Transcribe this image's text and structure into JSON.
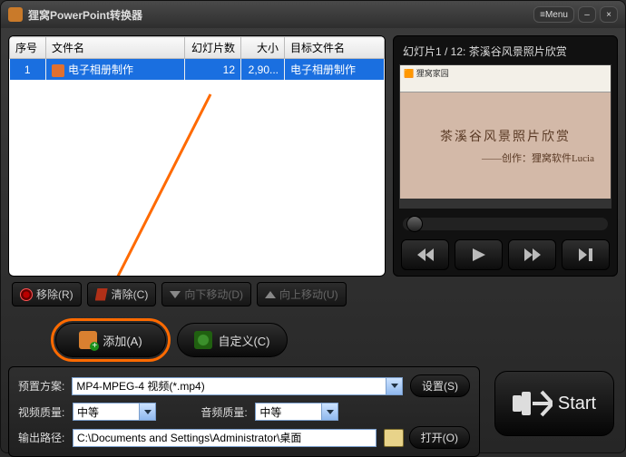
{
  "titlebar": {
    "title": "狸窝PowerPoint转换器",
    "menu": "≡Menu"
  },
  "table": {
    "headers": {
      "num": "序号",
      "name": "文件名",
      "slides": "幻灯片数",
      "size": "大小",
      "target": "目标文件名"
    },
    "rows": [
      {
        "num": "1",
        "name": "电子相册制作",
        "slides": "12",
        "size": "2,90...",
        "target": "电子相册制作"
      }
    ]
  },
  "toolbar": {
    "remove": "移除(R)",
    "clear": "清除(C)",
    "movedown": "向下移动(D)",
    "moveup": "向上移动(U)"
  },
  "bigbuttons": {
    "add": "添加(A)",
    "custom": "自定义(C)"
  },
  "preview": {
    "label": "幻灯片1 / 12: 茶溪谷风景照片欣赏",
    "slide_top": "狸窝家园",
    "slide_title": "茶溪谷风景照片欣赏",
    "slide_sub": "——创作：狸窝软件Lucia"
  },
  "settings": {
    "preset_label": "预置方案:",
    "preset_value": "MP4-MPEG-4 视频(*.mp4)",
    "set_btn": "设置(S)",
    "vq_label": "视频质量:",
    "vq_value": "中等",
    "aq_label": "音频质量:",
    "aq_value": "中等",
    "out_label": "输出路径:",
    "out_value": "C:\\Documents and Settings\\Administrator\\桌面",
    "open_btn": "打开(O)"
  },
  "start": "Start"
}
